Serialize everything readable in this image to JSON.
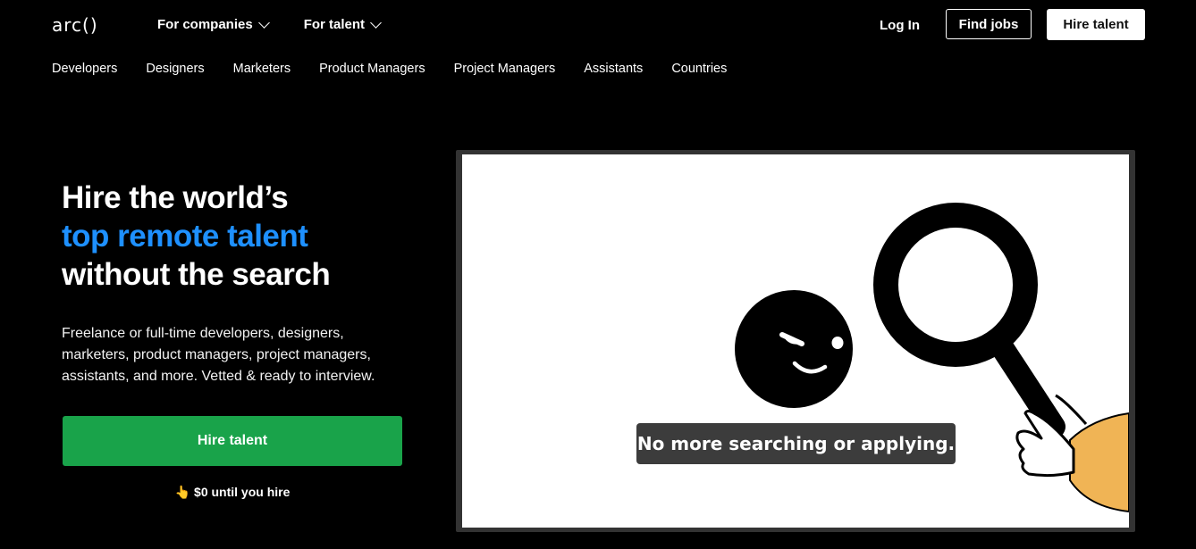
{
  "header": {
    "logo": "arc()",
    "menus": [
      {
        "label": "For companies"
      },
      {
        "label": "For talent"
      }
    ],
    "login_label": "Log In",
    "find_jobs_label": "Find jobs",
    "hire_talent_label": "Hire talent"
  },
  "subnav": {
    "items": [
      "Developers",
      "Designers",
      "Marketers",
      "Product Managers",
      "Project Managers",
      "Assistants",
      "Countries"
    ]
  },
  "hero": {
    "title_line1": "Hire the world’s",
    "title_accent": "top remote talent",
    "title_line3": "without the search",
    "description": "Freelance or full-time developers, designers, marketers, product managers, project managers, assistants, and more. Vetted & ready to interview.",
    "cta_label": "Hire talent",
    "note_icon": "👆",
    "note": "$0 until you hire"
  },
  "video": {
    "caption": "No more searching or applying."
  },
  "colors": {
    "accent_blue": "#1e90ff",
    "cta_green": "#19a34a",
    "sleeve_yellow": "#f0b455"
  }
}
